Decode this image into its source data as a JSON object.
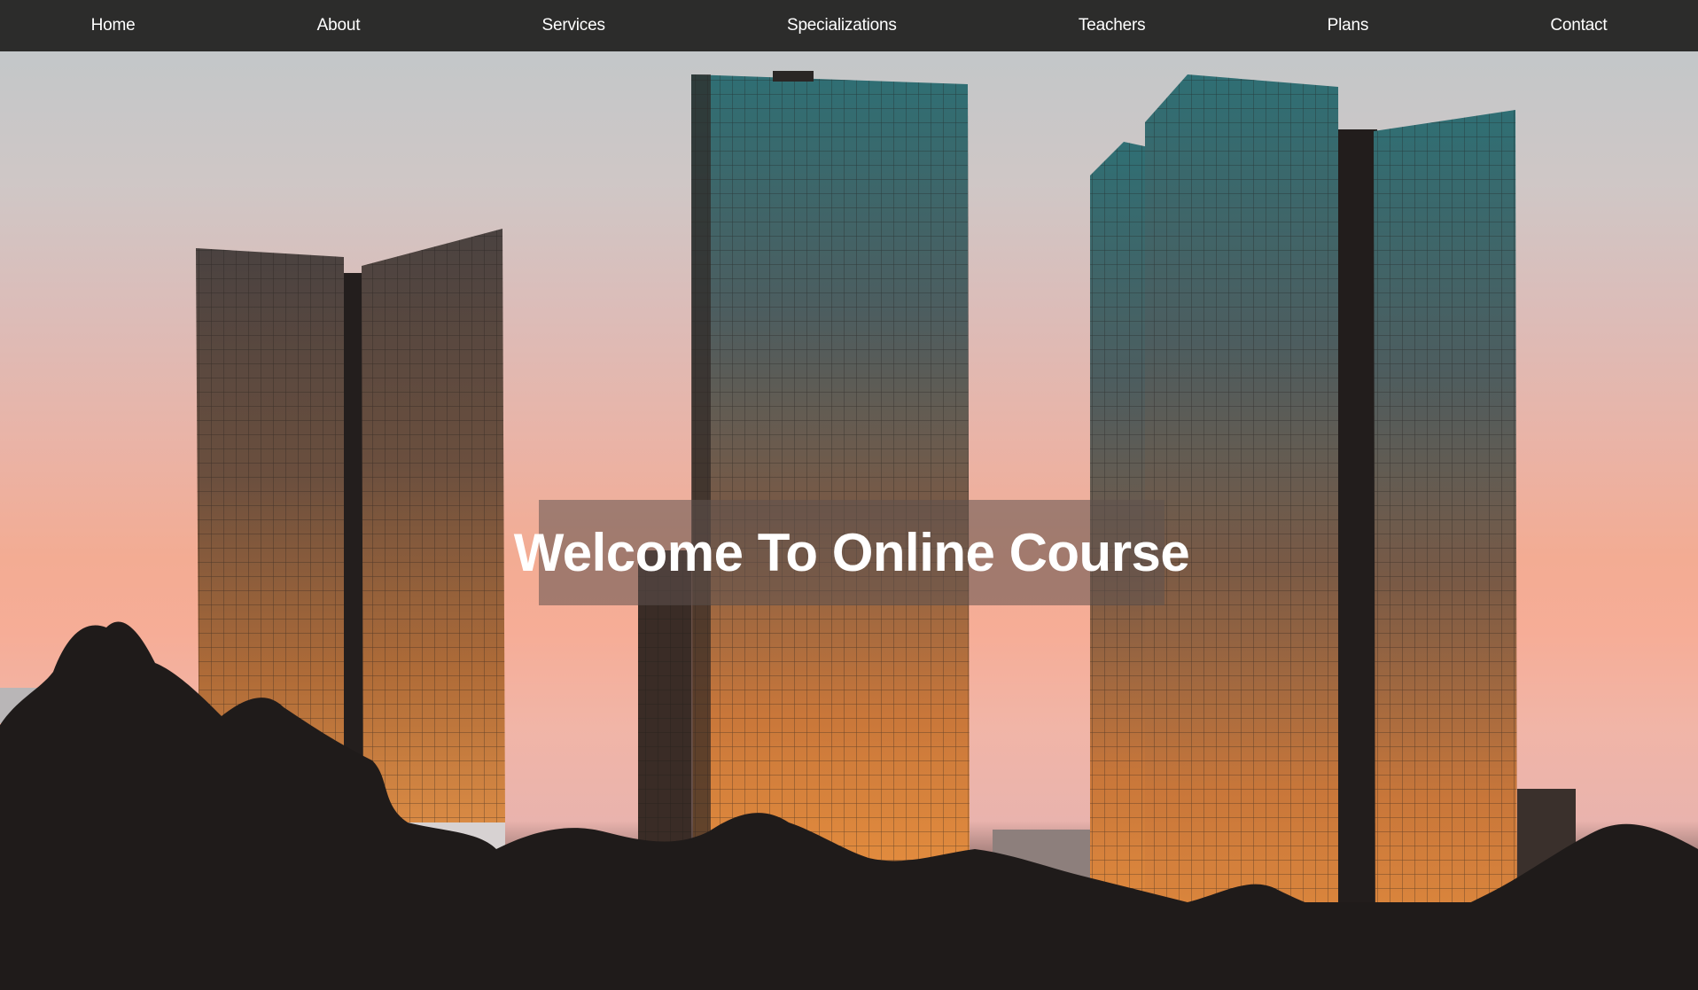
{
  "nav": {
    "items": [
      {
        "label": "Home"
      },
      {
        "label": "About"
      },
      {
        "label": "Services"
      },
      {
        "label": "Specializations"
      },
      {
        "label": "Teachers"
      },
      {
        "label": "Plans"
      },
      {
        "label": "Contact"
      }
    ]
  },
  "hero": {
    "title": "Welcome To Online Course",
    "background": "city skyline with glass towers at sunset",
    "overlay_color": "#5f524e"
  },
  "colors": {
    "navbar_bg": "#2c2c2b",
    "nav_text": "#ffffff",
    "title_text": "#ffffff"
  }
}
